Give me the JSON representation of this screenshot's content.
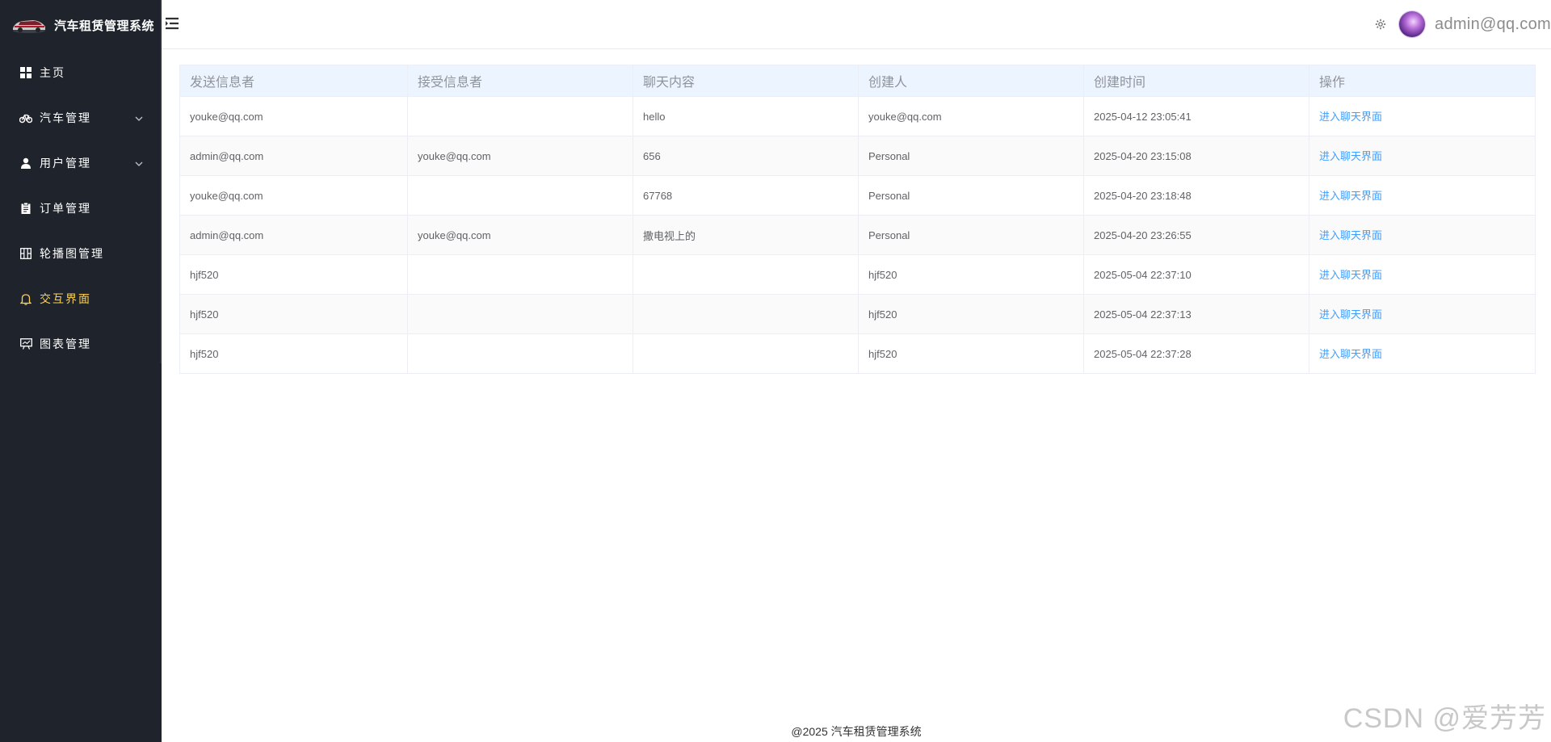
{
  "app": {
    "title": "汽车租赁管理系统"
  },
  "sidebar": {
    "items": [
      {
        "label": "主页",
        "icon": "grid-icon"
      },
      {
        "label": "汽车管理",
        "icon": "bicycle-icon",
        "has_children": true
      },
      {
        "label": "用户管理",
        "icon": "user-icon",
        "has_children": true
      },
      {
        "label": "订单管理",
        "icon": "clipboard-icon"
      },
      {
        "label": "轮播图管理",
        "icon": "carousel-icon"
      },
      {
        "label": "交互界面",
        "icon": "bell-icon",
        "active": true
      },
      {
        "label": "图表管理",
        "icon": "presentation-chart-icon"
      }
    ],
    "active_color": "#ffd04b",
    "background": "#1f242c"
  },
  "header": {
    "username": "admin@qq.com"
  },
  "table": {
    "columns": [
      "发送信息者",
      "接受信息者",
      "聊天内容",
      "创建人",
      "创建时间",
      "操作"
    ],
    "rows": [
      {
        "sender": "youke@qq.com",
        "receiver": "",
        "content": "hello",
        "creator": "youke@qq.com",
        "created": "2025-04-12 23:05:41",
        "action": "进入聊天界面"
      },
      {
        "sender": "admin@qq.com",
        "receiver": "youke@qq.com",
        "content": "656",
        "creator": "Personal",
        "created": "2025-04-20 23:15:08",
        "action": "进入聊天界面"
      },
      {
        "sender": "youke@qq.com",
        "receiver": "",
        "content": "67768",
        "creator": "Personal",
        "created": "2025-04-20 23:18:48",
        "action": "进入聊天界面"
      },
      {
        "sender": "admin@qq.com",
        "receiver": "youke@qq.com",
        "content": "撒电视上的",
        "creator": "Personal",
        "created": "2025-04-20 23:26:55",
        "action": "进入聊天界面"
      },
      {
        "sender": "hjf520",
        "receiver": "",
        "content": "",
        "creator": "hjf520",
        "created": "2025-05-04 22:37:10",
        "action": "进入聊天界面"
      },
      {
        "sender": "hjf520",
        "receiver": "",
        "content": "",
        "creator": "hjf520",
        "created": "2025-05-04 22:37:13",
        "action": "进入聊天界面"
      },
      {
        "sender": "hjf520",
        "receiver": "",
        "content": "",
        "creator": "hjf520",
        "created": "2025-05-04 22:37:28",
        "action": "进入聊天界面"
      }
    ],
    "header_background": "#ecf5ff",
    "link_color": "#409eff"
  },
  "footer": {
    "text": "@2025 汽车租赁管理系统"
  },
  "watermark": {
    "text": "CSDN @爱芳芳"
  }
}
